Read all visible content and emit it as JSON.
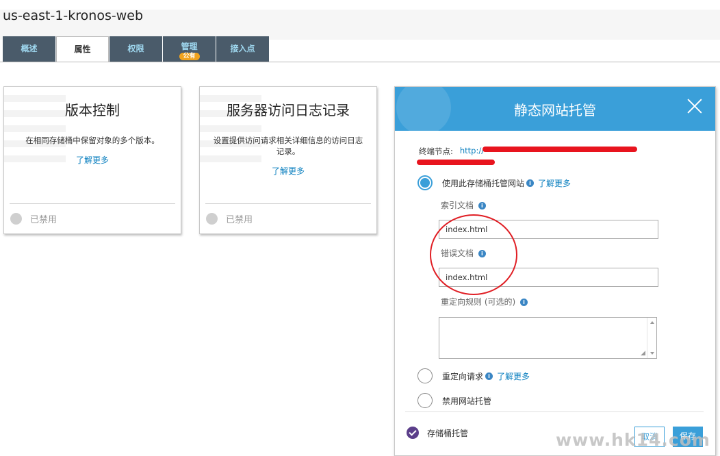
{
  "header": {
    "bucket_name": "us-east-1-kronos-web"
  },
  "tabs": [
    {
      "label": "概述"
    },
    {
      "label": "属性",
      "active": true
    },
    {
      "label": "权限"
    },
    {
      "label": "管理",
      "badge": "公有"
    },
    {
      "label": "接入点"
    }
  ],
  "cards": [
    {
      "title": "版本控制",
      "description": "在相同存储桶中保留对象的多个版本。",
      "learn_more": "了解更多",
      "status": "已禁用"
    },
    {
      "title": "服务器访问日志记录",
      "description": "设置提供访问请求相关详细信息的访问日志记录。",
      "learn_more": "了解更多",
      "status": "已禁用"
    }
  ],
  "static_hosting": {
    "title": "静态网站托管",
    "endpoint_label": "终端节点:",
    "endpoint_url": "http://",
    "options": {
      "host_website": {
        "label": "使用此存储桶托管网站",
        "learn_more": "了解更多",
        "selected": true
      },
      "redirect": {
        "label": "重定向请求",
        "learn_more": "了解更多",
        "selected": false
      },
      "disable": {
        "label": "禁用网站托管",
        "selected": false
      }
    },
    "index_label": "索引文档",
    "index_value": "index.html",
    "error_label": "错误文档",
    "error_value": "index.html",
    "redirect_rules_label": "重定向规则 (可选的)",
    "hosting_status": "存储桶托管",
    "cancel_label": "取消",
    "save_label": "保存"
  },
  "watermark": "www.hk14.com",
  "colors": {
    "accent": "#3a9fd9",
    "tab_bg": "#4a5b6a",
    "badge": "#f0a21e",
    "annotation": "#e01e24"
  }
}
